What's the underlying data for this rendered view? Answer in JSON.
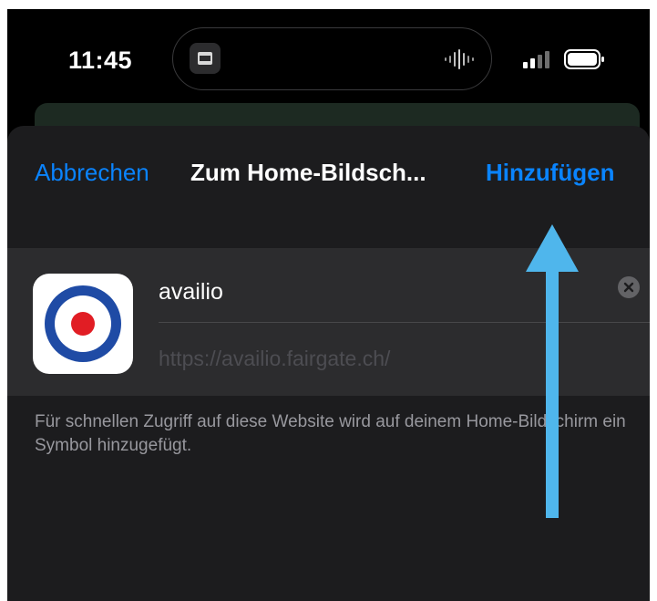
{
  "status_bar": {
    "time": "11:45",
    "signal_icon": "signal-bars-icon",
    "battery_icon": "battery-icon",
    "island_activity_icon": "audio-waveform-icon"
  },
  "sheet": {
    "cancel_label": "Abbrechen",
    "title": "Zum Home-Bildsch...",
    "add_label": "Hinzufügen",
    "app_name_value": "availio",
    "url": "https://availio.fairgate.ch/",
    "footnote": "Für schnellen Zugriff auf diese Website wird auf deinem Home-Bildschirm ein Symbol hinzugefügt."
  },
  "colors": {
    "accent": "#0a84ff",
    "sheet_background": "#1c1c1e",
    "group_background": "#2c2c2e",
    "annotation_arrow": "#4fb6ec",
    "icon_blue": "#1f4ba5",
    "icon_red": "#e11d24"
  }
}
